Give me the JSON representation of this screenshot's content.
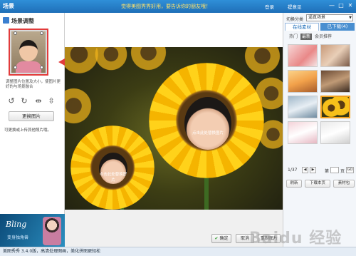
{
  "window": {
    "app_title": "场景",
    "slogan": "觉得美图秀秀好用，要告诉你的朋友哦！",
    "login_label": "登录",
    "feedback_label": "提意见",
    "minimize": "—",
    "maximize": "□",
    "close": "✕"
  },
  "left_panel": {
    "title": "场景调整",
    "help_text": "调整图片位置及大小，使图片更好的与场景融合",
    "tools": {
      "rotate_left": "↺",
      "rotate_right": "↻",
      "flip_horizontal": "⇹",
      "flip_vertical": "⇳"
    },
    "replace_button": "更换图片",
    "note": "可更换或上传其他照片哦。",
    "ad": {
      "title": "Bling",
      "subtitle": "变身独角兽"
    }
  },
  "canvas": {
    "face_label_large": "点击此处替换图片",
    "face_label_small": "点击此处替换图片"
  },
  "bottom_buttons": {
    "confirm": "确定",
    "cancel": "取消",
    "reset": "重制图片"
  },
  "right_panel": {
    "category_label": "切换分类",
    "category_value": "逼真场景",
    "tabs": [
      "在线素材",
      "已下载(4)"
    ],
    "subtabs": [
      "热门",
      "最新",
      "会员推荐"
    ],
    "active_subtab": 1,
    "page_indicator": "1/37",
    "page_prefix": "第",
    "page_suffix": "页",
    "go_label": "GO",
    "actions": {
      "refresh": "刷新",
      "download_page": "下载本页",
      "library": "素材包"
    }
  },
  "status_bar": {
    "text": "美图秀秀 3.4.0版，高清处理图画，美化拼图更轻松"
  },
  "watermark": "Baidu 经验",
  "colors": {
    "titlebar": "#1f6fb8",
    "accent": "#e23b3b",
    "selected_border": "#f0a020"
  }
}
